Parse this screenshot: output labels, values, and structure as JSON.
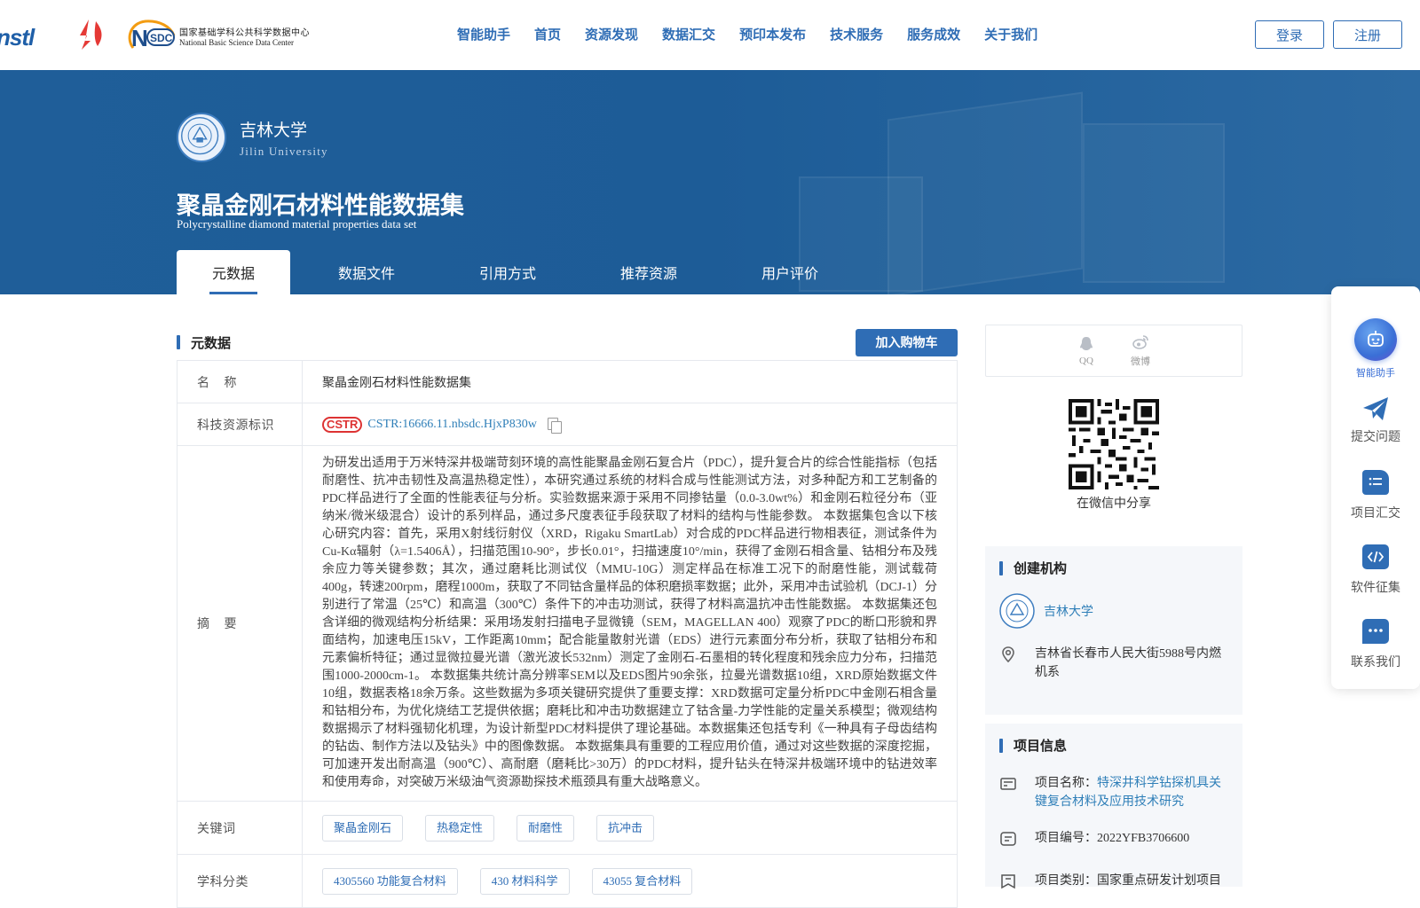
{
  "header": {
    "logo_nstl": "nstl",
    "logo_nsdc_cn": "国家基础学科公共科学数据中心",
    "logo_nsdc_en": "National Basic Science Data Center",
    "nav": [
      "智能助手",
      "首页",
      "资源发现",
      "数据汇交",
      "预印本发布",
      "技术服务",
      "服务成效",
      "关于我们"
    ],
    "login": "登录",
    "register": "注册"
  },
  "banner": {
    "institution_cn": "吉林大学",
    "institution_en": "Jilin University",
    "title": "聚晶金刚石材料性能数据集",
    "subtitle": "Polycrystalline diamond material properties data set",
    "tabs": [
      "元数据",
      "数据文件",
      "引用方式",
      "推荐资源",
      "用户评价"
    ],
    "active_tab": 0
  },
  "metadata": {
    "section_title": "元数据",
    "cart_button": "加入购物车",
    "name_label": "名    称",
    "name_value": "聚晶金刚石材料性能数据集",
    "cstr_label": "科技资源标识",
    "cstr_badge": "CSTR",
    "cstr_value": "CSTR:16666.11.nbsdc.HjxP830w",
    "abstract_label": "摘    要",
    "abstract": "为研发出适用于万米特深井极端苛刻环境的高性能聚晶金刚石复合片（PDC），提升复合片的综合性能指标（包括耐磨性、抗冲击韧性及高温热稳定性），本研究通过系统的材料合成与性能测试方法，对多种配方和工艺制备的PDC样品进行了全面的性能表征与分析。实验数据来源于采用不同掺钴量（0.0-3.0wt%）和金刚石粒径分布（亚纳米/微米级混合）设计的系列样品，通过多尺度表征手段获取了材料的结构与性能参数。 本数据集包含以下核心研究内容：首先，采用X射线衍射仪（XRD，Rigaku SmartLab）对合成的PDC样品进行物相表征，测试条件为Cu-Kα辐射（λ=1.5406Å），扫描范围10-90°，步长0.01°，扫描速度10°/min，获得了金刚石相含量、钴相分布及残余应力等关键参数；其次，通过磨耗比测试仪（MMU-10G）测定样品在标准工况下的耐磨性能，测试载荷400g，转速200rpm，磨程1000m，获取了不同钴含量样品的体积磨损率数据；此外，采用冲击试验机（DCJ-1）分别进行了常温（25℃）和高温（300℃）条件下的冲击功测试，获得了材料高温抗冲击性能数据。 本数据集还包含详细的微观结构分析结果：采用场发射扫描电子显微镜（SEM，MAGELLAN 400）观察了PDC的断口形貌和界面结构，加速电压15kV，工作距离10mm；配合能量散射光谱（EDS）进行元素面分布分析，获取了钴相分布和元素偏析特征；通过显微拉曼光谱（激光波长532nm）测定了金刚石-石墨相的转化程度和残余应力分布，扫描范围1000-2000cm-1。 本数据集共统计高分辨率SEM以及EDS图片90余张，拉曼光谱数据10组，XRD原始数据文件10组，数据表格18余万条。这些数据为多项关键研究提供了重要支撑：XRD数据可定量分析PDC中金刚石相含量和钴相分布，为优化烧结工艺提供依据；磨耗比和冲击功数据建立了钴含量-力学性能的定量关系模型；微观结构数据揭示了材料强韧化机理，为设计新型PDC材料提供了理论基础。本数据集还包括专利《一种具有子母齿结构的钻齿、制作方法以及钻头》中的图像数据。 本数据集具有重要的工程应用价值，通过对这些数据的深度挖掘，可加速开发出耐高温（900℃）、高耐磨（磨耗比>30万）的PDC材料，提升钻头在特深井极端环境中的钻进效率和使用寿命，对突破万米级油气资源勘探技术瓶颈具有重大战略意义。",
    "keywords_label": "关键词",
    "keywords": [
      "聚晶金刚石",
      "热稳定性",
      "耐磨性",
      "抗冲击"
    ],
    "subject_label": "学科分类",
    "subjects": [
      "4305560 功能复合材料",
      "430 材料科学",
      "43055 复合材料"
    ]
  },
  "share": {
    "qq": "QQ",
    "weibo": "微博",
    "wechat_caption": "在微信中分享"
  },
  "creator": {
    "title": "创建机构",
    "institution": "吉林大学",
    "address": "吉林省长春市人民大街5988号内燃机系"
  },
  "project": {
    "title": "项目信息",
    "name_label": "项目名称：",
    "name_value": "特深井科学钻探机具关键复合材料及应用技术研究",
    "code_label": "项目编号：",
    "code_value": "2022YFB3706600",
    "type_label": "项目类别：",
    "type_value": "国家重点研发计划项目"
  },
  "float_bar": [
    "智能助手",
    "提交问题",
    "项目汇交",
    "软件征集",
    "联系我们"
  ],
  "colors": {
    "primary": "#2f6db5",
    "banner": "#1f5e99",
    "link": "#2f7fb8"
  }
}
